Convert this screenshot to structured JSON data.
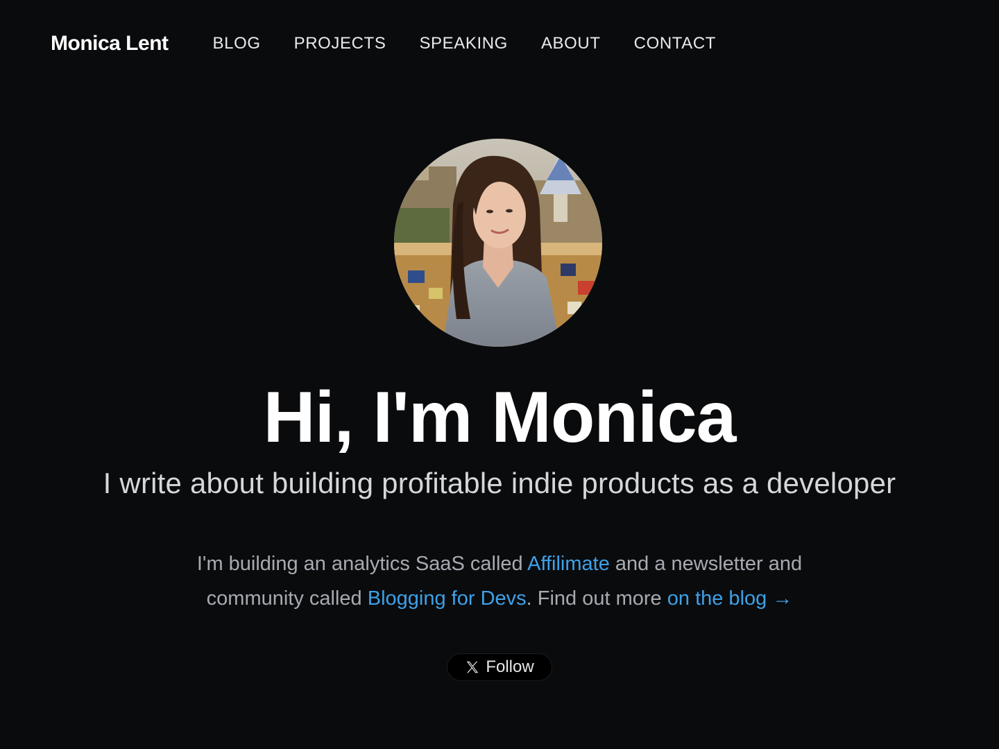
{
  "header": {
    "brand": "Monica Lent",
    "nav": [
      {
        "label": "BLOG"
      },
      {
        "label": "PROJECTS"
      },
      {
        "label": "SPEAKING"
      },
      {
        "label": "ABOUT"
      },
      {
        "label": "CONTACT"
      }
    ]
  },
  "hero": {
    "title": "Hi, I'm Monica",
    "subtitle": "I write about building profitable indie products as a developer"
  },
  "intro": {
    "part1": "I'm building an analytics SaaS called ",
    "link1": "Affilimate",
    "part2": " and a newsletter and community called ",
    "link2": "Blogging for Devs",
    "part3": ". Find out more ",
    "link3": "on the blog →"
  },
  "follow_button": {
    "label": "Follow",
    "icon": "x-logo-icon"
  },
  "colors": {
    "background": "#0a0b0d",
    "link": "#3ea1e8",
    "muted_text": "#a7abb1"
  }
}
